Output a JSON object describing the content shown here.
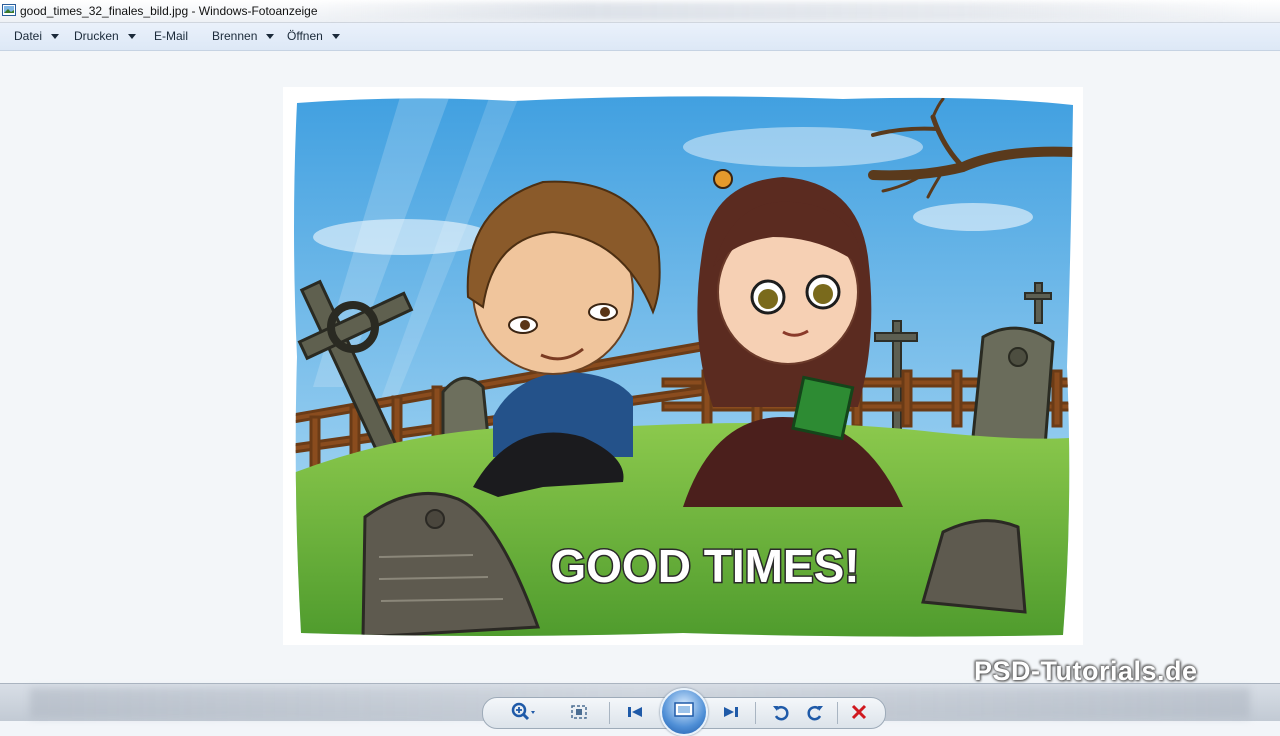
{
  "window": {
    "title": "good_times_32_finales_bild.jpg - Windows-Fotoanzeige"
  },
  "menu": {
    "items": [
      {
        "label": "Datei",
        "has_dropdown": true
      },
      {
        "label": "Drucken",
        "has_dropdown": true
      },
      {
        "label": "E-Mail",
        "has_dropdown": false
      },
      {
        "label": "Brennen",
        "has_dropdown": true
      },
      {
        "label": "Öffnen",
        "has_dropdown": true
      }
    ]
  },
  "image": {
    "headline": "GOOD TIMES!"
  },
  "watermark": "PSD-Tutorials.de",
  "controls": {
    "icons": [
      "zoom-icon",
      "actual-size-icon",
      "previous-icon",
      "slideshow-icon",
      "next-icon",
      "rotate-left-icon",
      "rotate-right-icon",
      "delete-icon"
    ]
  },
  "colors": {
    "accent": "#1f5aa8",
    "delete": "#d0191f",
    "sky": "#5eb3e6",
    "grass": "#6aae3a"
  }
}
